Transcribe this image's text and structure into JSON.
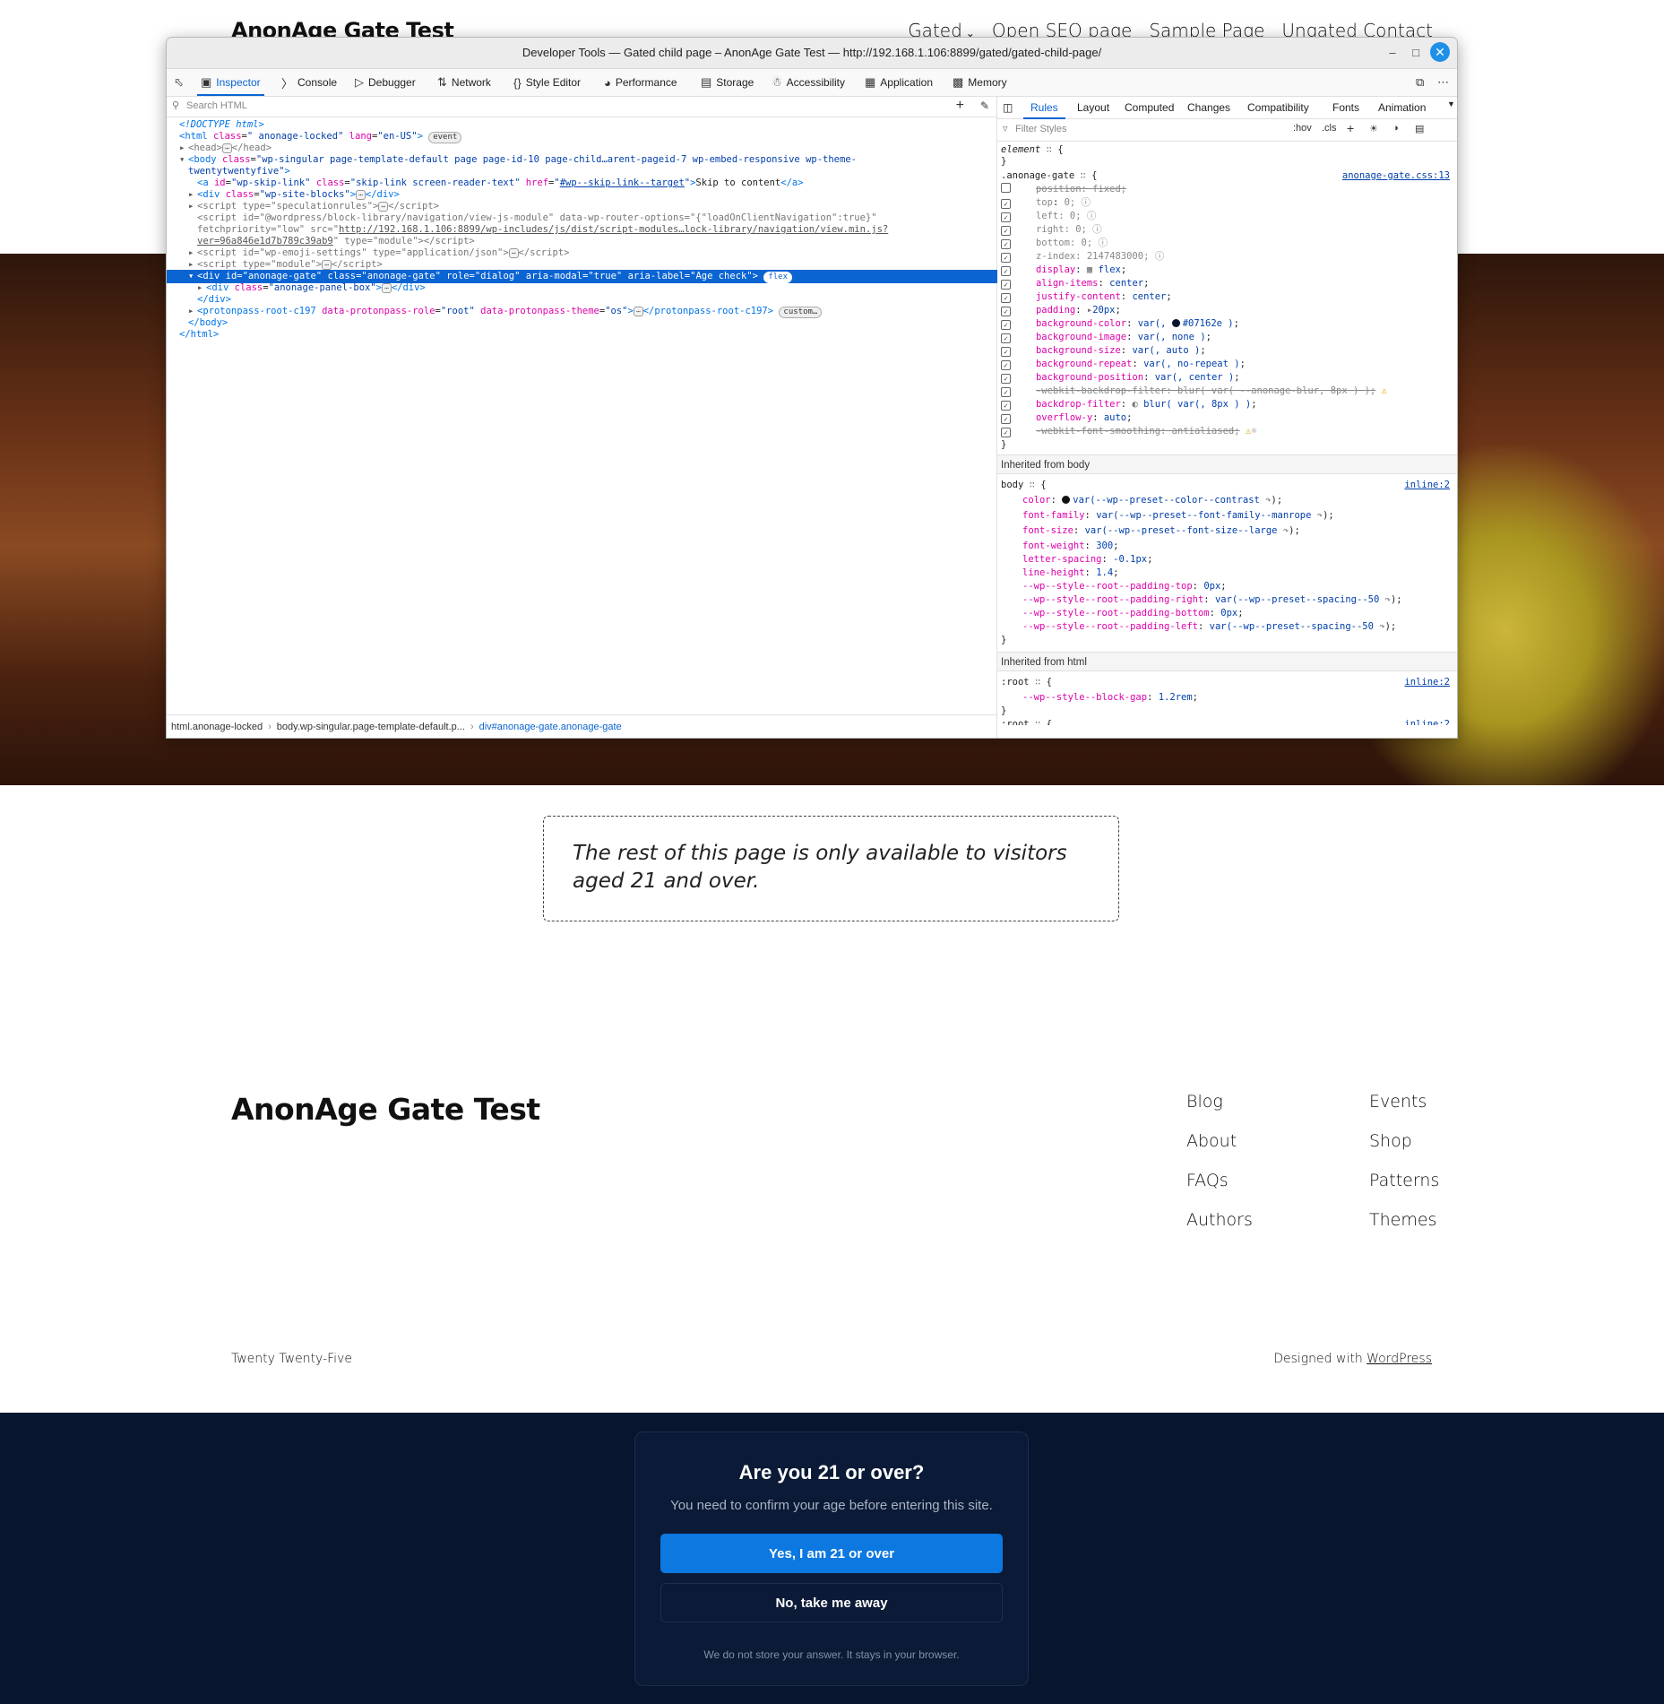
{
  "site": {
    "title": "AnonAge Gate Test",
    "nav": [
      "Gated",
      "Open SEO page",
      "Sample Page",
      "Ungated Contact"
    ],
    "notice": "The rest of this page is only available to visitors aged 21 and over.",
    "footer_title": "AnonAge Gate Test",
    "footer_col1": [
      "Blog",
      "About",
      "FAQs",
      "Authors"
    ],
    "footer_col2": [
      "Events",
      "Shop",
      "Patterns",
      "Themes"
    ],
    "credit_left": "Twenty Twenty-Five",
    "credit_right_prefix": "Designed with ",
    "credit_right_link": "WordPress"
  },
  "gate": {
    "title": "Are you 21 or over?",
    "subtitle": "You need to confirm your age before entering this site.",
    "yes_label": "Yes, I am 21 or over",
    "no_label": "No, take me away",
    "footnote": "We do not store your answer. It stays in your browser."
  },
  "devtools": {
    "window_title": "Developer Tools — Gated child page – AnonAge Gate Test — http://192.168.1.106:8899/gated/gated-child-page/",
    "tools": [
      "Inspector",
      "Console",
      "Debugger",
      "Network",
      "Style Editor",
      "Performance",
      "Storage",
      "Accessibility",
      "Application",
      "Memory"
    ],
    "search_placeholder": "Search HTML",
    "right_tabs": [
      "Rules",
      "Layout",
      "Computed",
      "Changes",
      "Compatibility",
      "Fonts",
      "Animation"
    ],
    "filter_placeholder": "Filter Styles",
    "filter_buttons": [
      ":hov",
      ".cls"
    ],
    "breadcrumb": [
      "html.anonage-locked",
      "body.wp-singular.page-template-default.p...",
      "div#anonage-gate.anonage-gate"
    ],
    "inherited_body": "Inherited from body",
    "inherited_html": "Inherited from html",
    "colors": {
      "accent": "#0a64d2",
      "gate_bg": "#07162e",
      "gate_button": "#0c78e0",
      "rule_swatch": "#07162e"
    }
  }
}
